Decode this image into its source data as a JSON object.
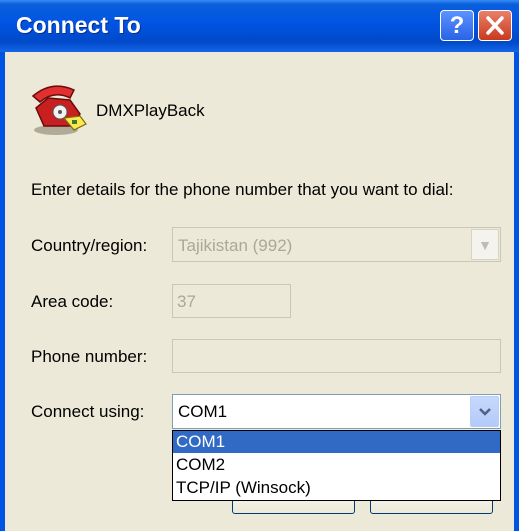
{
  "window": {
    "title": "Connect To"
  },
  "title_buttons": {
    "help": "?"
  },
  "connection": {
    "name": "DMXPlayBack"
  },
  "instructions": "Enter details for the phone number that you want to dial:",
  "fields": {
    "country_label": "Country/region:",
    "country_value": "Tajikistan (992)",
    "area_label": "Area code:",
    "area_value": "37",
    "phone_label": "Phone number:",
    "phone_value": "",
    "connect_label": "Connect using:",
    "connect_value": "COM1"
  },
  "dropdown": {
    "options": [
      "COM1",
      "COM2",
      "TCP/IP (Winsock)"
    ],
    "selected_index": 0
  },
  "colors": {
    "titlebar": "#0054e3",
    "selection": "#316ac5",
    "dialog_bg": "#ece9d8"
  },
  "icons": {
    "app": "telephone-icon",
    "help": "help-icon",
    "close": "close-icon",
    "arrow": "chevron-down-icon"
  }
}
